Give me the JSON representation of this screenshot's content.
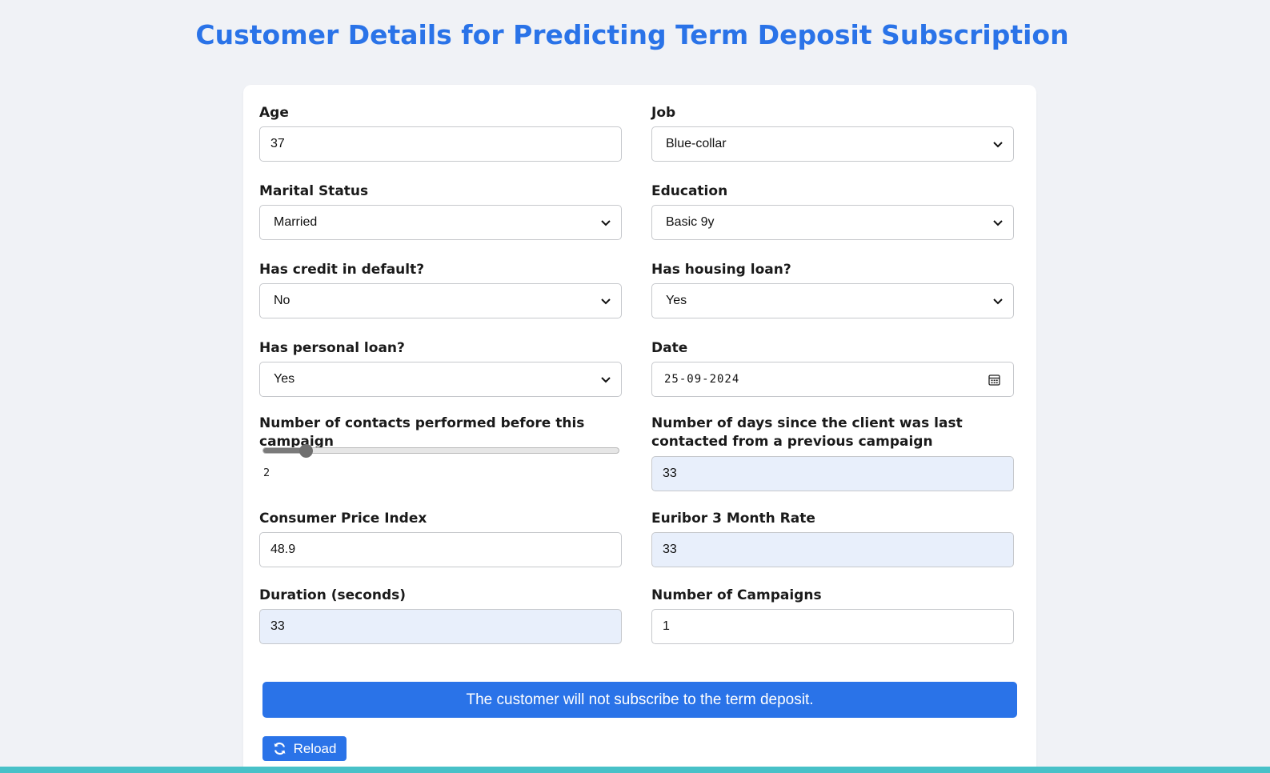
{
  "page": {
    "title": "Customer Details for Predicting Term Deposit Subscription"
  },
  "form": {
    "age": {
      "label": "Age",
      "value": "37"
    },
    "job": {
      "label": "Job",
      "value": "Blue-collar"
    },
    "marital": {
      "label": "Marital Status",
      "value": "Married"
    },
    "education": {
      "label": "Education",
      "value": "Basic 9y"
    },
    "default": {
      "label": "Has credit in default?",
      "value": "No"
    },
    "housing": {
      "label": "Has housing loan?",
      "value": "Yes"
    },
    "personal_loan": {
      "label": "Has personal loan?",
      "value": "Yes"
    },
    "date": {
      "label": "Date",
      "value": "25-09-2024"
    },
    "previous_contacts": {
      "label": "Number of contacts performed before this campaign",
      "value": "2",
      "fraction": 0.12
    },
    "pdays": {
      "label": "Number of days since the client was last contacted from a previous campaign",
      "value": "33"
    },
    "cpi": {
      "label": "Consumer Price Index",
      "value": "48.9"
    },
    "euribor": {
      "label": "Euribor 3 Month Rate",
      "value": "33"
    },
    "duration": {
      "label": "Duration (seconds)",
      "value": "33"
    },
    "campaigns": {
      "label": "Number of Campaigns",
      "value": "1"
    }
  },
  "result": {
    "message": "The customer will not subscribe to the term deposit."
  },
  "actions": {
    "reload_label": "Reload",
    "reload_icon": "refresh-icon"
  },
  "colors": {
    "accent": "#2a73e8",
    "filled_input": "#e8effb",
    "page_bg": "#f0f2f6",
    "bottom_stripe": "#48c1c8"
  }
}
